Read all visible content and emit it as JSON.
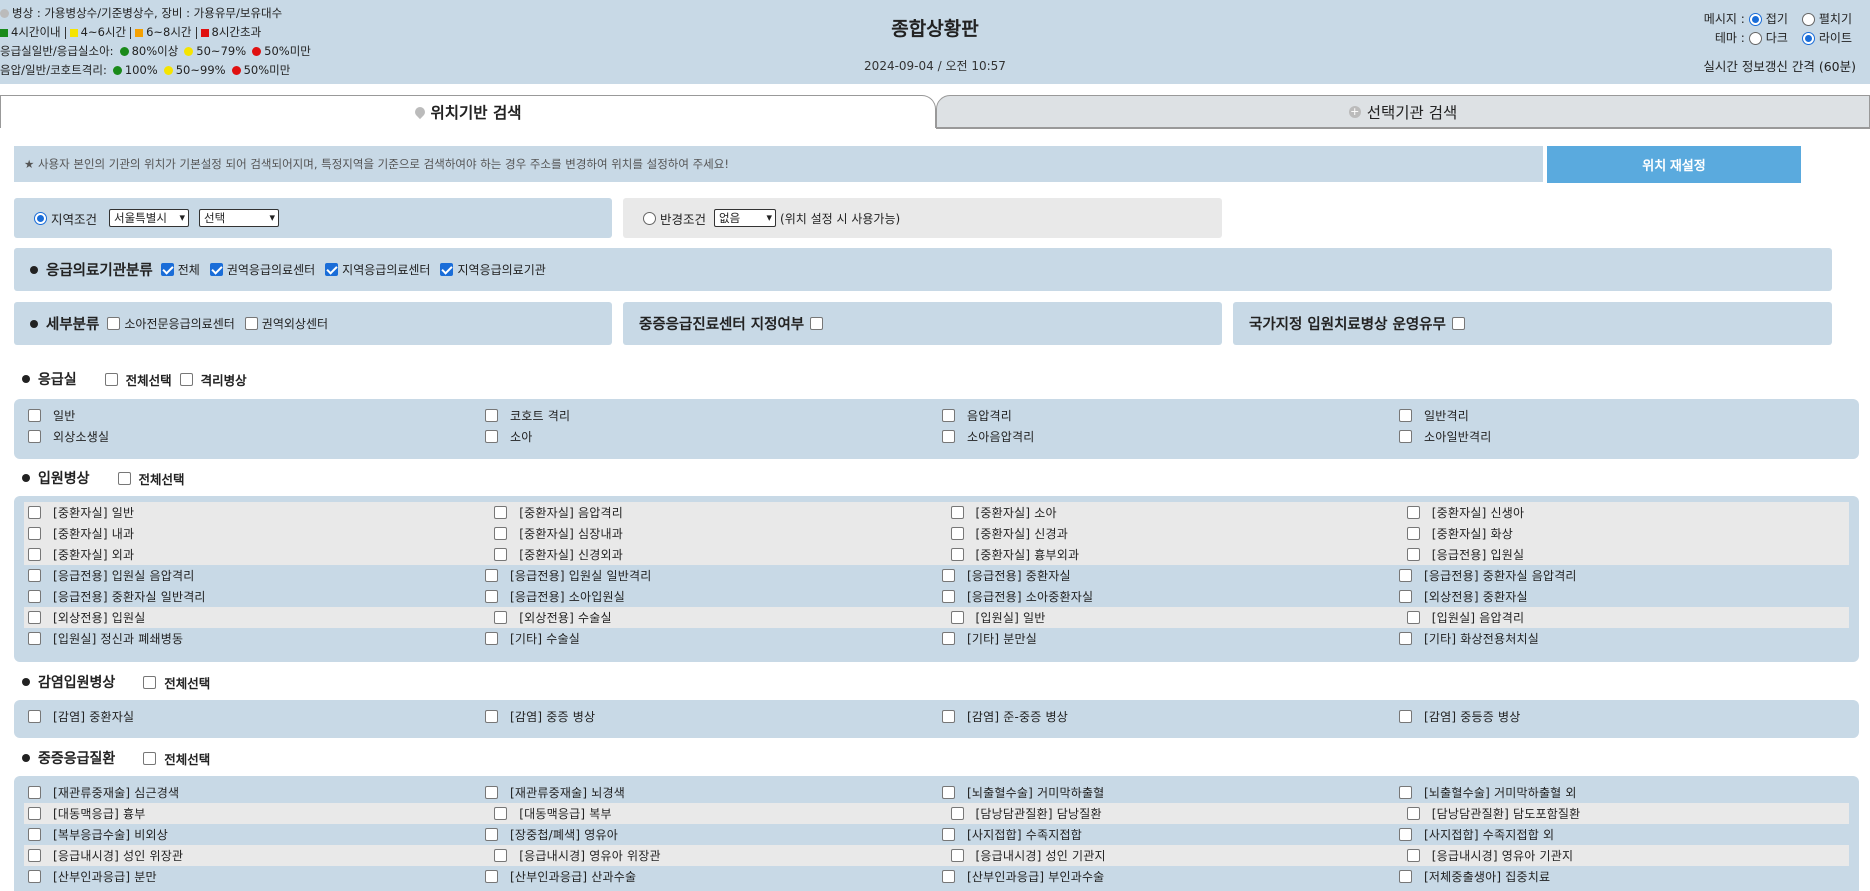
{
  "header": {
    "legend_line1": "병상 : 가용병상수/기준병상수, 장비 : 가용유무/보유대수",
    "legend_line2": [
      {
        "label": "4시간이내",
        "color": "#1a8a1a"
      },
      {
        "label": "4~6시간",
        "color": "#f5e400"
      },
      {
        "label": "6~8시간",
        "color": "#f5a000"
      },
      {
        "label": "8시간초과",
        "color": "#e01010"
      }
    ],
    "legend_line3_label": "응급실일반/응급실소아:",
    "legend_line3": [
      {
        "label": "80%이상",
        "color": "#1a8a1a"
      },
      {
        "label": "50~79%",
        "color": "#f5e400"
      },
      {
        "label": "50%미만",
        "color": "#e01010"
      }
    ],
    "legend_line4_label": "음압/일반/코호트격리:",
    "legend_line4": [
      {
        "label": "100%",
        "color": "#1a8a1a"
      },
      {
        "label": "50~99%",
        "color": "#f5e400"
      },
      {
        "label": "50%미만",
        "color": "#e01010"
      }
    ],
    "title": "종합상황판",
    "datetime": "2024-09-04 / 오전 10:57",
    "message_label": "메시지 :",
    "message_collapse": "접기",
    "message_expand": "펼치기",
    "theme_label": "테마 :",
    "theme_dark": "다크",
    "theme_light": "라이트",
    "refresh_text": "실시간 정보갱신 간격 (60분)"
  },
  "tabs": {
    "location": "위치기반 검색",
    "institution": "선택기관 검색"
  },
  "notice": "★ 사용자 본인의 기관의 위치가 기본설정 되어 검색되어지며, 특정지역을 기준으로 검색하여야 하는 경우 주소를 변경하여 위치를 설정하여 주세요!",
  "reset_button": "위치 재설정",
  "region": {
    "label": "지역조건",
    "city": "서울특별시",
    "district": "선택"
  },
  "radius": {
    "label": "반경조건",
    "value": "없음",
    "note": "(위치 설정 시 사용가능)"
  },
  "classification": {
    "title": "응급의료기관분류",
    "options": [
      "전체",
      "권역응급의료센터",
      "지역응급의료센터",
      "지역응급의료기관"
    ]
  },
  "detail": {
    "title": "세부분류",
    "options": [
      "소아전문응급의료센터",
      "권역외상센터"
    ]
  },
  "severe_center": "중증응급진료센터 지정여부",
  "national_bed": "국가지정 입원치료병상 운영유무",
  "sections": {
    "er": {
      "title": "응급실",
      "select_all": "전체선택",
      "isolation": "격리병상"
    },
    "inpatient": {
      "title": "입원병상",
      "select_all": "전체선택"
    },
    "infection": {
      "title": "감염입원병상",
      "select_all": "전체선택"
    },
    "severe": {
      "title": "중증응급질환",
      "select_all": "전체선택"
    }
  },
  "er_items": [
    [
      "일반",
      "코호트 격리",
      "음압격리",
      "일반격리"
    ],
    [
      "외상소생실",
      "소아",
      "소아음압격리",
      "소아일반격리"
    ]
  ],
  "inpatient_items": [
    [
      "[중환자실] 일반",
      "[중환자실] 음압격리",
      "[중환자실] 소아",
      "[중환자실] 신생아"
    ],
    [
      "[중환자실] 내과",
      "[중환자실] 심장내과",
      "[중환자실] 신경과",
      "[중환자실] 화상"
    ],
    [
      "[중환자실] 외과",
      "[중환자실] 신경외과",
      "[중환자실] 흉부외과",
      "[응급전용] 입원실"
    ],
    [
      "[응급전용] 입원실 음압격리",
      "[응급전용] 입원실 일반격리",
      "[응급전용] 중환자실",
      "[응급전용] 중환자실 음압격리"
    ],
    [
      "[응급전용] 중환자실 일반격리",
      "[응급전용] 소아입원실",
      "[응급전용] 소아중환자실",
      "[외상전용] 중환자실"
    ],
    [
      "[외상전용] 입원실",
      "[외상전용] 수술실",
      "[입원실] 일반",
      "[입원실] 음압격리"
    ],
    [
      "[입원실] 정신과 폐쇄병동",
      "[기타] 수술실",
      "[기타] 분만실",
      "[기타] 화상전용처치실"
    ]
  ],
  "infection_items": [
    [
      "[감염] 중환자실",
      "[감염] 중증 병상",
      "[감염] 준-중증 병상",
      "[감염] 중등증 병상"
    ]
  ],
  "severe_items": [
    [
      "[재관류중재술] 심근경색",
      "[재관류중재술] 뇌경색",
      "[뇌출혈수술] 거미막하출혈",
      "[뇌출혈수술] 거미막하출혈 외"
    ],
    [
      "[대동맥응급] 흉부",
      "[대동맥응급] 복부",
      "[담낭담관질환] 담낭질환",
      "[담낭담관질환] 담도포함질환"
    ],
    [
      "[복부응급수술] 비외상",
      "[장중첩/폐색] 영유아",
      "[사지접합] 수족지접합",
      "[사지접합] 수족지접합 외"
    ],
    [
      "[응급내시경] 성인 위장관",
      "[응급내시경] 영유아 위장관",
      "[응급내시경] 성인 기관지",
      "[응급내시경] 영유아 기관지"
    ],
    [
      "[산부인과응급] 분만",
      "[산부인과응급] 산과수술",
      "[산부인과응급] 부인과수술",
      "[저체중출생아] 집중치료"
    ]
  ]
}
